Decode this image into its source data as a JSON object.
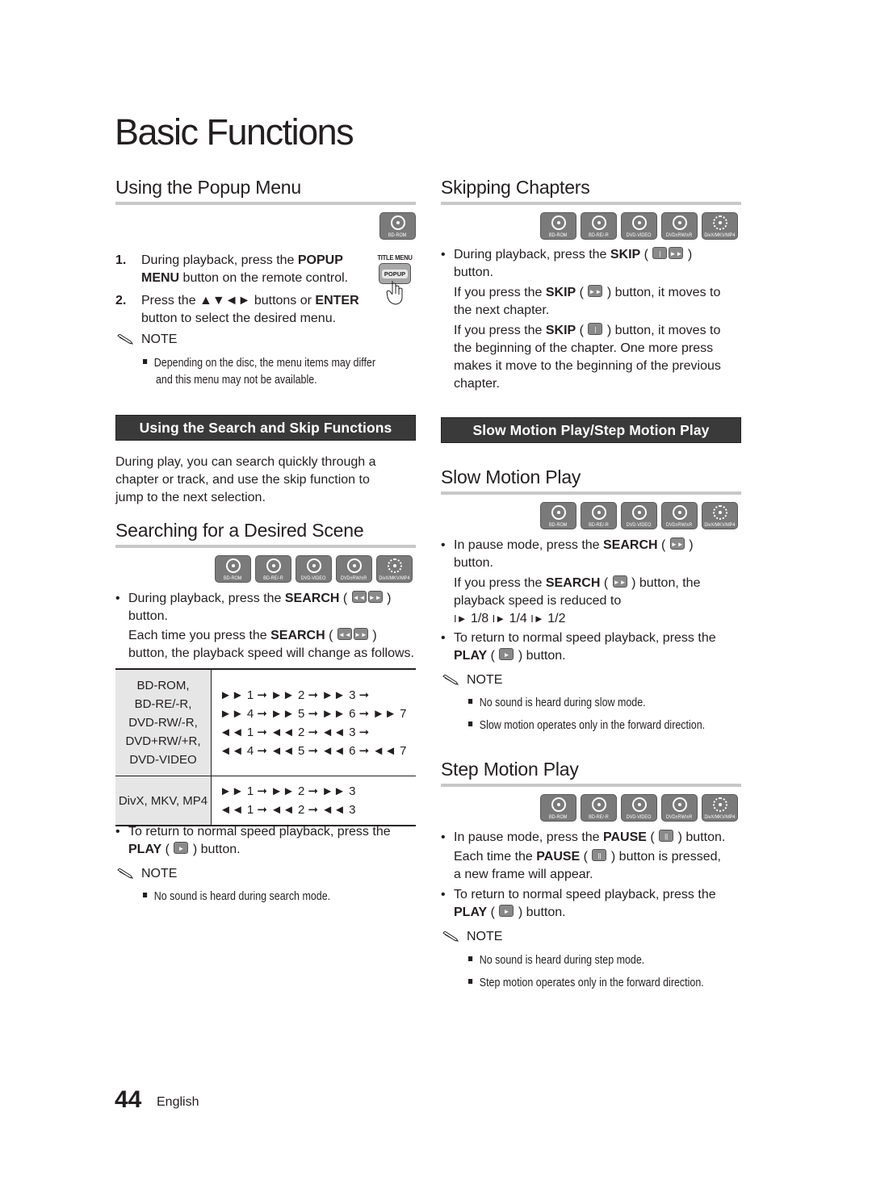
{
  "page": {
    "title": "Basic Functions",
    "page_number": "44",
    "language": "English"
  },
  "disc_labels": {
    "bd_rom": "BD-ROM",
    "bd_re_r": "BD-RE/-R",
    "dvd_video": "DVD-VIDEO",
    "dvd_rw_r": "DVD±RW/±R",
    "divx": "DivX/MKV/MP4"
  },
  "popup_menu": {
    "heading": "Using the Popup Menu",
    "remote_label": "TITLE MENU",
    "remote_button": "POPUP",
    "steps": [
      {
        "num": "1.",
        "pre": "During playback, press the ",
        "bold": "POPUP MENU",
        "post": " button on the remote control."
      },
      {
        "num": "2.",
        "pre": "Press the ▲▼◄► buttons or ",
        "bold": "ENTER",
        "post": " button to select the desired menu."
      }
    ],
    "note_title": "NOTE",
    "notes": [
      "Depending on the disc, the menu items may differ",
      "and this menu may not be available."
    ]
  },
  "search_skip": {
    "banner": "Using the Search and Skip Functions",
    "intro": [
      "During play, you can search quickly through a",
      "chapter or track, and use the skip function to",
      "jump to the next selection."
    ]
  },
  "searching": {
    "heading": "Searching for a Desired Scene",
    "bullet1_pre": "During playback, press the ",
    "bullet1_bold": "SEARCH",
    "bullet1_post": "button.",
    "bullet1_sub_pre": "Each time you press the ",
    "bullet1_sub_bold": "SEARCH",
    "bullet1_sub_post": "button, the playback speed will change as follows.",
    "table": {
      "rows": [
        {
          "formats": [
            "BD-ROM,",
            "BD-RE/-R,",
            "DVD-RW/-R,",
            "DVD+RW/+R,",
            "DVD-VIDEO"
          ],
          "speeds": [
            "►► 1 ➞ ►► 2 ➞ ►► 3 ➞",
            "►► 4 ➞ ►► 5 ➞ ►► 6 ➞ ►► 7",
            "◄◄ 1 ➞ ◄◄ 2 ➞ ◄◄ 3 ➞",
            "◄◄ 4 ➞ ◄◄ 5 ➞ ◄◄ 6 ➞ ◄◄ 7"
          ]
        },
        {
          "formats": [
            "DivX, MKV, MP4"
          ],
          "speeds": [
            "►► 1 ➞ ►► 2 ➞ ►► 3",
            "◄◄ 1 ➞ ◄◄ 2 ➞ ◄◄ 3"
          ]
        }
      ]
    },
    "bullet2_pre": "To return to normal speed playback, press the",
    "bullet2_bold": "PLAY",
    "bullet2_post": "button.",
    "note_title": "NOTE",
    "notes": [
      "No sound is heard during search mode."
    ]
  },
  "skipping": {
    "heading": "Skipping Chapters",
    "b1_pre": "During playback, press the ",
    "b1_bold": "SKIP",
    "b1_post": "button.",
    "p1_pre": "If you press the ",
    "p1_bold": "SKIP",
    "p1_post": " button, it moves to",
    "p1_line2": "the next chapter.",
    "p2_pre": "If you press the ",
    "p2_bold": "SKIP",
    "p2_post": " button, it moves to",
    "p2_lines": [
      "the beginning of the chapter. One more press",
      "makes it move to the beginning of the previous",
      "chapter."
    ]
  },
  "slow_step_banner": "Slow Motion Play/Step Motion Play",
  "slow_motion": {
    "heading": "Slow Motion Play",
    "b1_pre": "In pause mode, press the ",
    "b1_bold": "SEARCH",
    "b1_post": "button.",
    "p1_pre": "If you press the ",
    "p1_bold": "SEARCH",
    "p1_post": " button, the",
    "p1_line2": "playback speed is reduced to",
    "speeds": [
      "1/8",
      "1/4",
      "1/2"
    ],
    "b2_pre": "To return to normal speed playback, press the",
    "b2_bold": "PLAY",
    "b2_post": "button.",
    "note_title": "NOTE",
    "notes": [
      "No sound is heard during slow mode.",
      "Slow motion operates only in the forward direction."
    ]
  },
  "step_motion": {
    "heading": "Step Motion Play",
    "b1_pre": "In pause mode, press the ",
    "b1_bold": "PAUSE",
    "b1_post": " button.",
    "p1_pre": "Each time the ",
    "p1_bold": "PAUSE",
    "p1_post": " button is pressed,",
    "p1_line2": "a new frame will appear.",
    "b2_pre": "To return to normal speed playback, press the",
    "b2_bold": "PLAY",
    "b2_post": "button.",
    "note_title": "NOTE",
    "notes": [
      "No sound is heard during step mode.",
      "Step motion operates only in the forward direction."
    ]
  },
  "icons": {
    "rewind": "◄◄",
    "forward": "►►",
    "skip_back": "|◄◄",
    "skip_fwd": "►►|",
    "play": "►",
    "pause": "||",
    "step": "I►"
  }
}
